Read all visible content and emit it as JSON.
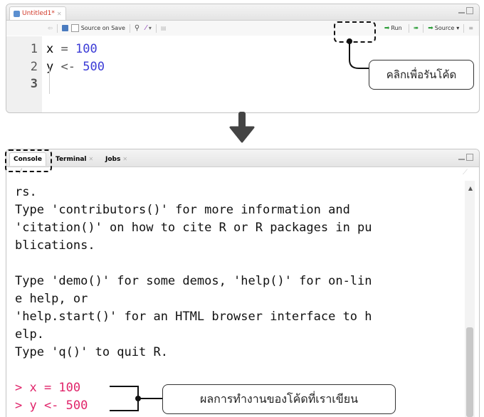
{
  "editor": {
    "tab_title": "Untitled1*",
    "source_on_save": "Source on Save",
    "run_label": "Run",
    "source_label": "Source",
    "lines": [
      {
        "no": "1",
        "lhs": "x",
        "op": "=",
        "val": "100"
      },
      {
        "no": "2",
        "lhs": "y",
        "op": "<-",
        "val": "500"
      },
      {
        "no": "3",
        "lhs": "",
        "op": "",
        "val": ""
      }
    ]
  },
  "callout_run": "คลิกเพื่อรันโค้ด",
  "console": {
    "tabs": [
      "Console",
      "Terminal",
      "Jobs"
    ],
    "path": "~/",
    "lines": [
      "rs.",
      "Type 'contributors()' for more information and",
      "'citation()' on how to cite R or R packages in pu",
      "blications.",
      "",
      "Type 'demo()' for some demos, 'help()' for on-lin",
      "e help, or",
      "'help.start()' for an HTML browser interface to h",
      "elp.",
      "Type 'q()' to quit R.",
      ""
    ],
    "prompt_lines": [
      "> x = 100",
      "> y <- 500"
    ]
  },
  "callout_result": "ผลการทำงานของโค้ดที่เราเขียน",
  "colors": {
    "prompt": "#e0246a",
    "number": "#3b3bd6",
    "run_arrow": "#2e9e3a",
    "tab_title": "#d23a2a"
  },
  "icons": [
    "rstudio-file-icon",
    "back-icon",
    "save-icon",
    "search-icon",
    "wand-icon",
    "page-icon",
    "run-arrow-icon",
    "rerun-icon",
    "source-icon",
    "menu-icon",
    "down-arrow-icon",
    "minimize-icon",
    "maximize-icon",
    "broom-icon",
    "scroll-up-icon"
  ]
}
